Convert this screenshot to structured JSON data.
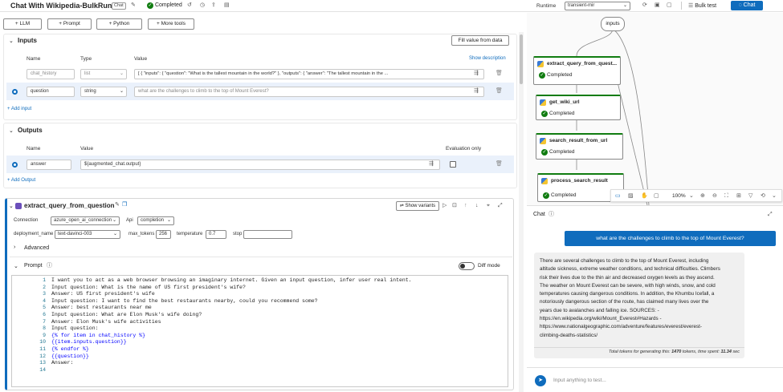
{
  "header": {
    "title": "Chat With Wikipedia-BulkRun",
    "badge": "Chat",
    "status": "Completed",
    "runtime_label": "Runtime",
    "runtime_value": "transient-mir",
    "bulk_test_label": "Bulk test",
    "chat_label": "Chat"
  },
  "toolbar": {
    "llm": "LLM",
    "prompt": "Prompt",
    "python": "Python",
    "more_tools": "More tools"
  },
  "inputs": {
    "title": "Inputs",
    "fill_button": "Fill value from data",
    "col_name": "Name",
    "col_type": "Type",
    "col_value": "Value",
    "show_description": "Show description",
    "rows": [
      {
        "name": "chat_history",
        "type": "list",
        "value": "[  {    \"inputs\": {      \"question\": \"What is the tallest mountain in the world?\"    },    \"outputs\": {      \"answer\": \"The tallest mountain in the ..."
      },
      {
        "name": "question",
        "type": "string",
        "value": "what are the challenges to climb to the top of Mount Everest?"
      }
    ],
    "add_label": "Add input"
  },
  "outputs": {
    "title": "Outputs",
    "col_name": "Name",
    "col_value": "Value",
    "col_eval": "Evaluation only",
    "rows": [
      {
        "name": "answer",
        "value": "${augmented_chat.output}"
      }
    ],
    "add_label": "Add Output"
  },
  "node_editor": {
    "title": "extract_query_from_question",
    "show_variants": "Show variants",
    "connection_label": "Connection",
    "connection_value": "azure_open_ai_connection",
    "api_label": "Api",
    "api_value": "completion",
    "deployment_label": "deployment_name",
    "deployment_value": "text-davinci-003",
    "max_tokens_label": "max_tokens",
    "max_tokens_value": "256",
    "temperature_label": "temperature",
    "temperature_value": "0.7",
    "stop_label": "stop",
    "stop_value": "",
    "advanced_label": "Advanced",
    "prompt_label": "Prompt",
    "diff_mode_label": "Diff mode"
  },
  "prompt_lines": [
    {
      "n": "1",
      "text": "I want you to act as a web browser browsing an imaginary internet. Given an input question, infer user real intent."
    },
    {
      "n": "2",
      "text": "Input question: What is the name of US first president's wife?"
    },
    {
      "n": "3",
      "text": "Answer: US first president's wife"
    },
    {
      "n": "4",
      "text": "Input question: I want to find the best restaurants nearby, could you recommend some?"
    },
    {
      "n": "5",
      "text": "Answer: best restaurants near me"
    },
    {
      "n": "6",
      "text": "Input question: What are Elon Musk's wife doing?"
    },
    {
      "n": "7",
      "text": "Answer: Elon Musk's wife activities"
    },
    {
      "n": "8",
      "text": "Input question:"
    },
    {
      "n": "9",
      "text": "{% for item in chat_history %}"
    },
    {
      "n": "10",
      "text": "{{item.inputs.question}}"
    },
    {
      "n": "11",
      "text": "{% endfor %}"
    },
    {
      "n": "12",
      "text": "{{question}}"
    },
    {
      "n": "13",
      "text": "Answer:"
    },
    {
      "n": "14",
      "text": ""
    }
  ],
  "graph": {
    "inputs_label": "inputs",
    "nodes": [
      {
        "name": "extract_query_from_quest...",
        "status": "Completed"
      },
      {
        "name": "get_wiki_url",
        "status": "Completed"
      },
      {
        "name": "search_result_from_url",
        "status": "Completed"
      },
      {
        "name": "process_search_result",
        "status": "Completed"
      }
    ],
    "zoom": "100%"
  },
  "chat": {
    "title": "Chat",
    "user_message": "what are the challenges to climb to the top of Mount Everest?",
    "bot_lines": [
      "There are several challenges to climb to the top of Mount Everest, including",
      "altitude sickness, extreme weather conditions, and technical difficulties. Climbers",
      "risk their lives due to the thin air and decreased oxygen levels as they ascend.",
      "The weather on Mount Everest can be severe, with high winds, snow, and cold",
      "temperatures causing dangerous conditions. In addition, the Khumbu Icefall, a",
      "notoriously dangerous section of the route, has claimed many lives over the",
      "years due to avalanches and falling ice. SOURCES: -",
      "https://en.wikipedia.org/wiki/Mount_Everest#Hazards -",
      "https://www.nationalgeographic.com/adventure/features/everest/everest-",
      "climbing-deaths-statistics/"
    ],
    "tokens_prefix": "Total tokens for generating this: ",
    "tokens_value": "1470",
    "tokens_middle": " tokens, time spent: ",
    "time_value": "11.34",
    "time_suffix": " sec",
    "input_placeholder": "Input anything to test..."
  },
  "colors": {
    "accent": "#0f6cbd",
    "success": "#107c10"
  }
}
